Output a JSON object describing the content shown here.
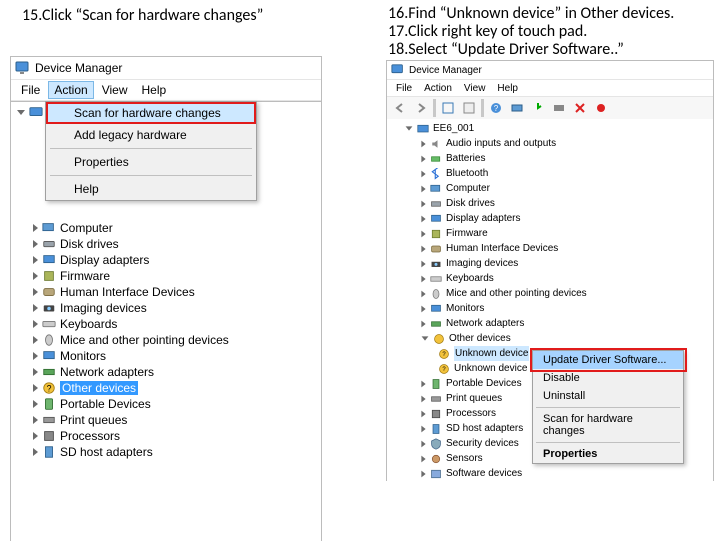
{
  "instructions": {
    "i15": "15.Click “Scan for hardware changes”",
    "i16": "16.Find “Unknown device” in Other devices.",
    "i17": "17.Click right key of touch pad.",
    "i18": "18.Select “Update Driver Software..”"
  },
  "left": {
    "title": "Device Manager",
    "menus": {
      "file": "File",
      "action": "Action",
      "view": "View",
      "help": "Help"
    },
    "action_menu": {
      "scan": "Scan for hardware changes",
      "add": "Add legacy hardware",
      "properties": "Properties",
      "help": "Help"
    },
    "root_blank": " ",
    "cats": {
      "computer": "Computer",
      "disk": "Disk drives",
      "display": "Display adapters",
      "firmware": "Firmware",
      "hid": "Human Interface Devices",
      "imaging": "Imaging devices",
      "keyboards": "Keyboards",
      "mice": "Mice and other pointing devices",
      "monitors": "Monitors",
      "network": "Network adapters",
      "other": "Other devices",
      "portable": "Portable Devices",
      "print": "Print queues",
      "processors": "Processors",
      "sdhost": "SD host adapters"
    }
  },
  "right": {
    "title": "Device Manager",
    "menus": {
      "file": "File",
      "action": "Action",
      "view": "View",
      "help": "Help"
    },
    "root": "EE6_001",
    "cats": {
      "audio": "Audio inputs and outputs",
      "batteries": "Batteries",
      "bluetooth": "Bluetooth",
      "computer": "Computer",
      "disk": "Disk drives",
      "display": "Display adapters",
      "firmware": "Firmware",
      "hid": "Human Interface Devices",
      "imaging": "Imaging devices",
      "keyboards": "Keyboards",
      "mice": "Mice and other pointing devices",
      "monitors": "Monitors",
      "network": "Network adapters",
      "other": "Other devices",
      "unknown1": "Unknown device",
      "unknown2": "Unknown device",
      "portable": "Portable Devices",
      "print": "Print queues",
      "processors": "Processors",
      "sdhost": "SD host adapters",
      "security": "Security devices",
      "sensors": "Sensors",
      "software": "Software devices"
    },
    "context": {
      "update": "Update Driver Software...",
      "disable": "Disable",
      "uninstall": "Uninstall",
      "scan": "Scan for hardware changes",
      "properties": "Properties"
    }
  }
}
